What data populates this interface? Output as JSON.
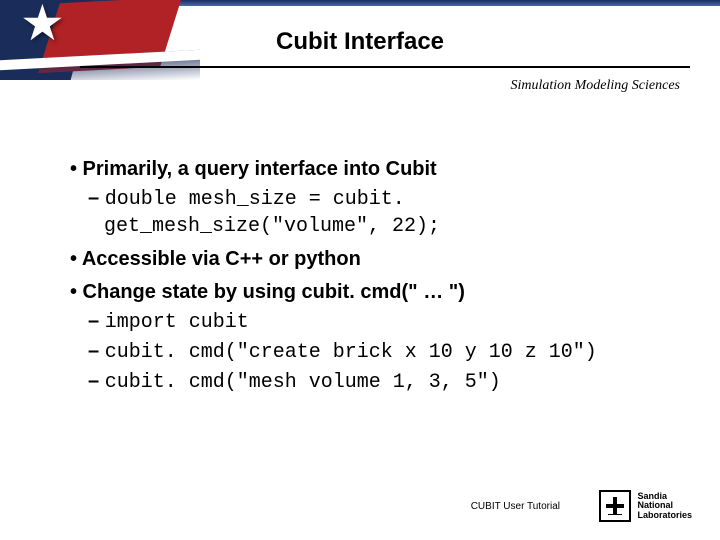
{
  "title": "Cubit Interface",
  "department": "Simulation Modeling Sciences",
  "bullets": {
    "b1": "• Primarily, a query interface into Cubit",
    "b1a_code": "double mesh_size = cubit. get_mesh_size(\"volume\", 22);",
    "b2": "• Accessible via C++ or python",
    "b3": "• Change state by using cubit. cmd(\" … \")",
    "b3a_code": "import cubit",
    "b3b_code": "cubit. cmd(\"create brick x 10 y 10 z 10\")",
    "b3c_code": "cubit. cmd(\"mesh volume 1, 3, 5\")"
  },
  "footer": {
    "tutorial": "CUBIT User Tutorial",
    "lab1": "Sandia",
    "lab2": "National",
    "lab3": "Laboratories"
  }
}
